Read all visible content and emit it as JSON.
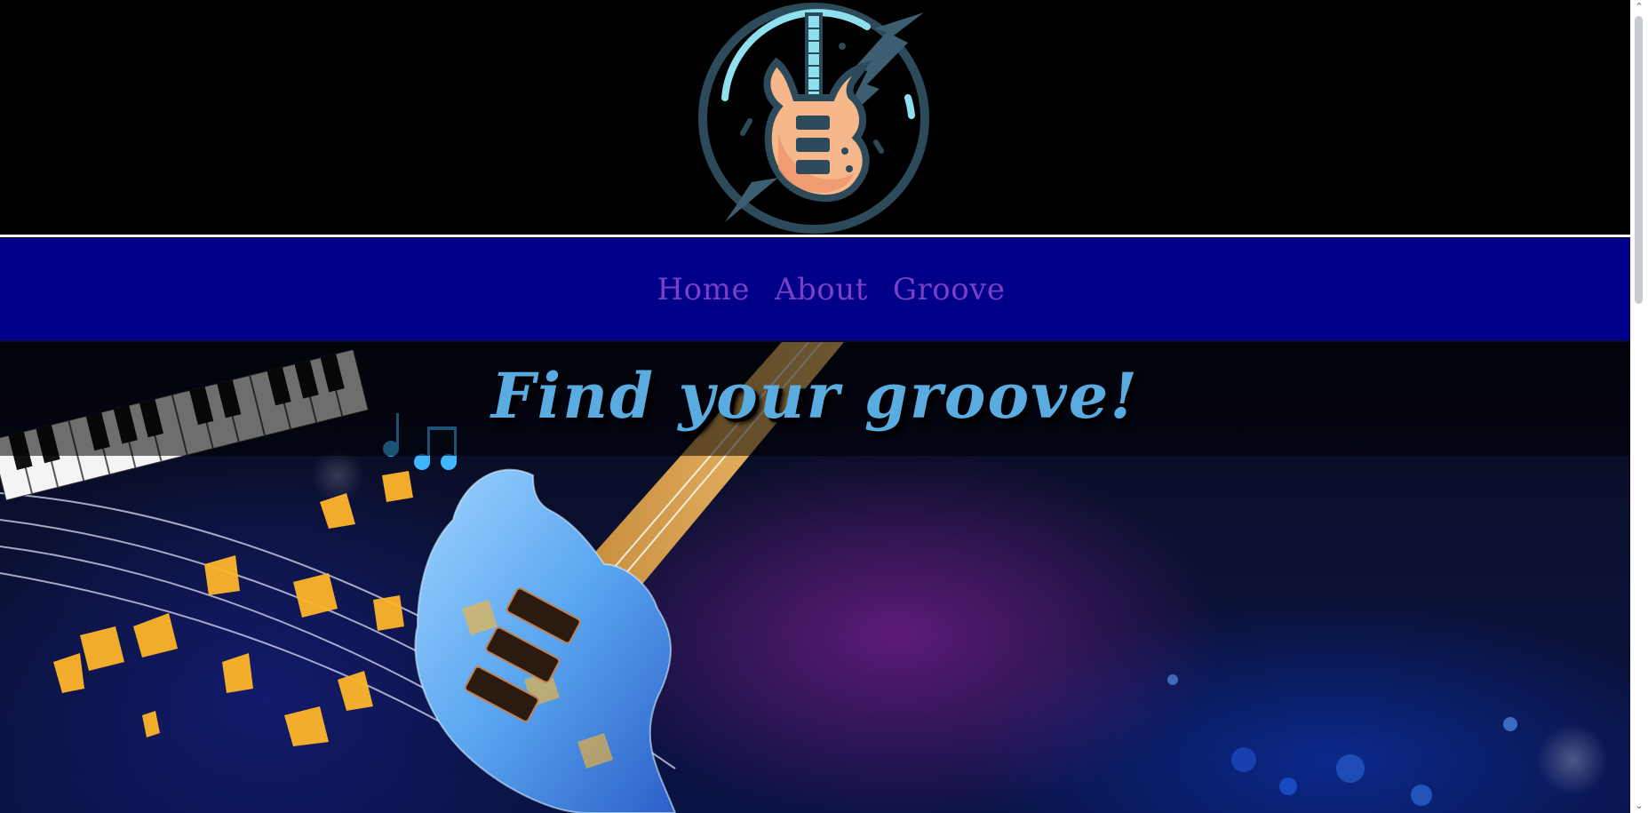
{
  "header": {
    "logo_icon": "guitar-logo-icon"
  },
  "nav": {
    "items": [
      {
        "label": "Home"
      },
      {
        "label": "About"
      },
      {
        "label": "Groove"
      }
    ]
  },
  "hero": {
    "title": "Find your groove!",
    "image_icon": "guitar-piano-music-artwork"
  },
  "colors": {
    "nav_background": "#00008b",
    "nav_link": "#7a3fc4",
    "hero_title": "#5aace0",
    "header_background": "#000000"
  },
  "scrollbar": {
    "up_icon": "chevron-up-icon",
    "down_icon": "chevron-down-icon"
  }
}
